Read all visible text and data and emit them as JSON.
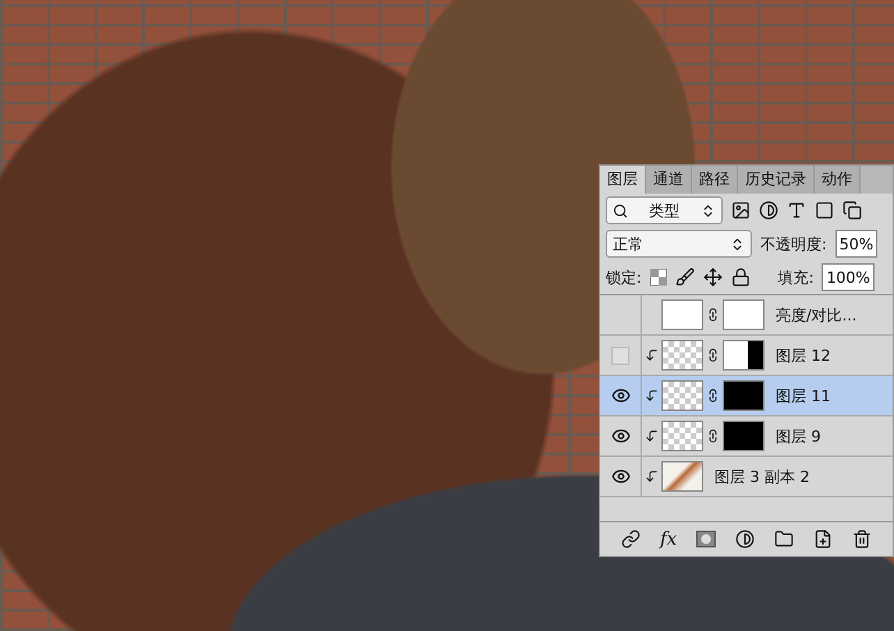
{
  "panel": {
    "tabs": [
      {
        "label": "图层",
        "selected": true
      },
      {
        "label": "通道",
        "selected": false
      },
      {
        "label": "路径",
        "selected": false
      },
      {
        "label": "历史记录",
        "selected": false
      },
      {
        "label": "动作",
        "selected": false
      }
    ],
    "filter": {
      "value": "类型"
    },
    "blend": {
      "value": "正常",
      "opacity_label": "不透明度:",
      "opacity": "50%"
    },
    "lock": {
      "label": "锁定:",
      "fill_label": "填充:",
      "fill": "100%"
    },
    "layers": [
      {
        "name": "亮度/对比...",
        "kind": "adjustment",
        "visible": false,
        "selected": false,
        "clipped": false,
        "mask": {
          "kind": "white"
        }
      },
      {
        "name": "图层 12",
        "kind": "pixel",
        "visible": false,
        "selected": false,
        "clipped": true,
        "mask": {
          "kind": "split"
        }
      },
      {
        "name": "图层 11",
        "kind": "pixel",
        "visible": true,
        "selected": true,
        "clipped": true,
        "mask": {
          "kind": "black"
        }
      },
      {
        "name": "图层 9",
        "kind": "pixel",
        "visible": true,
        "selected": false,
        "clipped": true,
        "mask": {
          "kind": "black"
        }
      },
      {
        "name": "图层 3 副本 2",
        "kind": "photo",
        "visible": true,
        "selected": false,
        "clipped": true
      }
    ],
    "footer": {
      "fx": "fx"
    }
  }
}
